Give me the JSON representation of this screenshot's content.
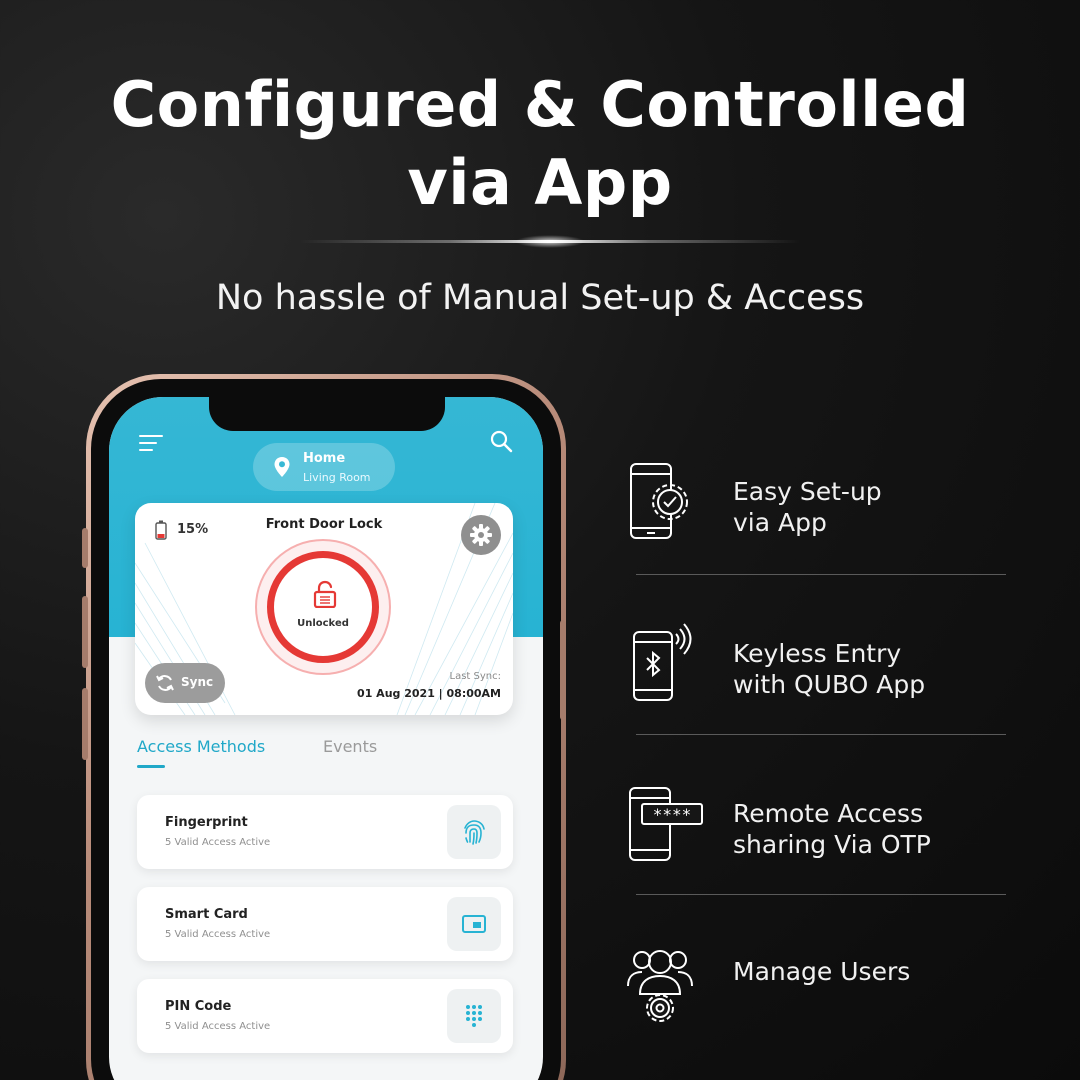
{
  "headline": {
    "line1": "Configured & Controlled",
    "line2": "via App"
  },
  "subtitle": "No hassle of Manual Set-up & Access",
  "app": {
    "location": {
      "title": "Home",
      "subtitle": "Living Room"
    },
    "lock_card": {
      "battery": "15%",
      "title": "Front Door Lock",
      "state": "Unlocked",
      "sync_label": "Sync",
      "last_sync_label": "Last Sync:",
      "last_sync_value": "01 Aug 2021 | 08:00AM"
    },
    "tabs": [
      {
        "label": "Access Methods",
        "active": true
      },
      {
        "label": "Events",
        "active": false
      }
    ],
    "methods": [
      {
        "name": "Fingerprint",
        "status": "5 Valid Access Active",
        "icon": "fingerprint-icon"
      },
      {
        "name": "Smart Card",
        "status": "5 Valid Access Active",
        "icon": "card-icon"
      },
      {
        "name": "PIN Code",
        "status": "5 Valid Access Active",
        "icon": "keypad-icon"
      }
    ],
    "colors": {
      "accent": "#27b3d3",
      "lock_red": "#e53935"
    }
  },
  "features": [
    {
      "line1": "Easy Set-up",
      "line2": "via App",
      "icon": "phone-gear-icon"
    },
    {
      "line1": "Keyless Entry",
      "line2": "with QUBO App",
      "icon": "phone-bluetooth-icon"
    },
    {
      "line1": "Remote Access",
      "line2": "sharing Via OTP",
      "icon": "phone-otp-icon"
    },
    {
      "line1": "Manage Users",
      "line2": "",
      "icon": "users-gear-icon"
    }
  ]
}
